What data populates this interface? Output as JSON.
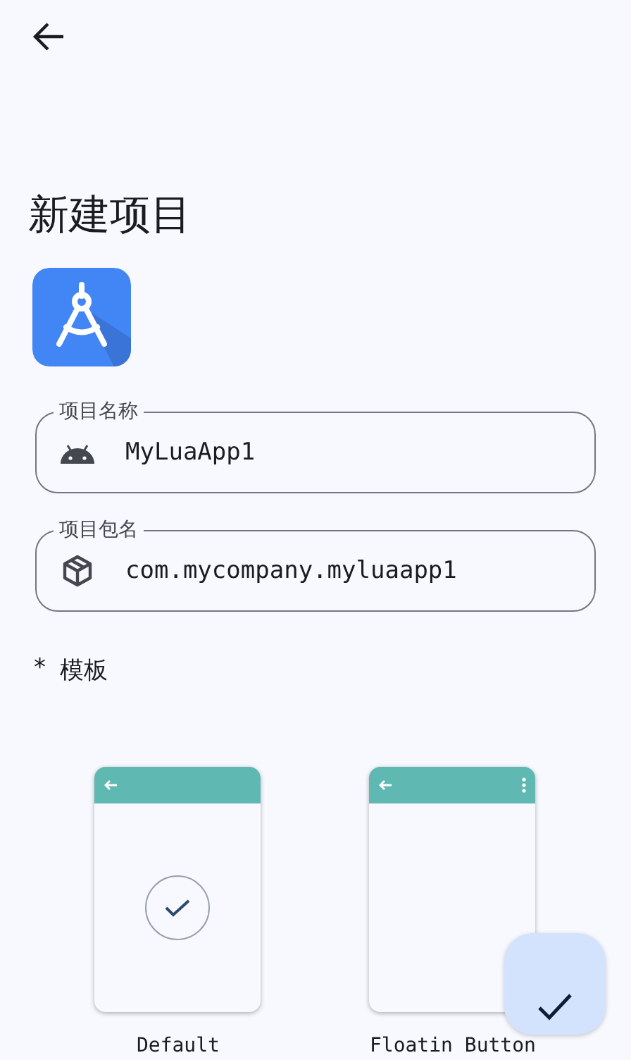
{
  "title": "新建项目",
  "fields": [
    {
      "kind": "android",
      "label": "项目名称",
      "value": "MyLuaApp1"
    },
    {
      "kind": "package",
      "label": "项目包名",
      "value": "com.mycompany.myluaapp1"
    }
  ],
  "templates_section": {
    "required_mark": "*",
    "label": "模板"
  },
  "templates": [
    {
      "kind": "default",
      "name": "Default",
      "selected": true
    },
    {
      "kind": "menu",
      "name": "Floatin Button",
      "selected": false
    }
  ]
}
